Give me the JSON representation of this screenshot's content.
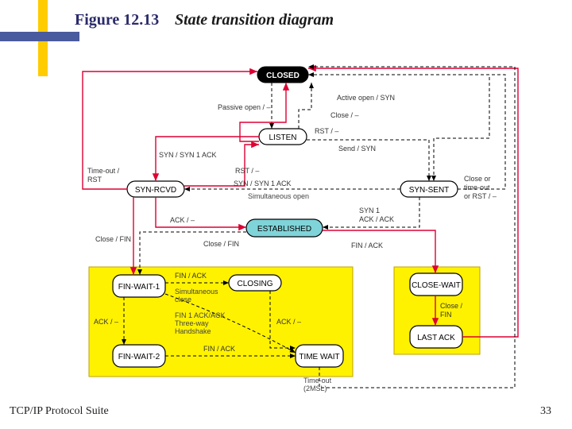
{
  "header": {
    "figure": "Figure 12.13",
    "title": "State transition diagram"
  },
  "footer": {
    "left": "TCP/IP Protocol Suite",
    "page": "33"
  },
  "states": {
    "closed": "CLOSED",
    "listen": "LISTEN",
    "syn_rcvd": "SYN-RCVD",
    "syn_sent": "SYN-SENT",
    "established": "ESTABLISHED",
    "fin_wait_1": "FIN-​WAIT-1",
    "closing": "CLOSING",
    "fin_wait_2": "FIN-​WAIT-2",
    "time_wait": "TIME​ WAIT",
    "close_wait": "CLOSE-​WAIT",
    "last_ack": "LAST​ ACK"
  },
  "edges": {
    "passive_open": "Passive open / –",
    "active_open": "Active open / SYN",
    "close": "Close / –",
    "rst": "RST / –",
    "syn_syn1ack": "SYN / SYN 1 ACK",
    "send_syn": "Send / SYN",
    "ack": "ACK / –",
    "syn1_ackack_l1": "SYN 1",
    "syn1_ackack_l2": "ACK / ACK",
    "sim_open": "Simultaneous open",
    "timeout_rst_l1": "Time-out /",
    "timeout_rst_l2": "RST",
    "close_fin": "Close / FIN",
    "fin_ack": "FIN / ACK",
    "sim_close_l1": "Simultaneous",
    "sim_close_l2": "close",
    "threeway_l1": "FIN 1 ACK/ACK",
    "threeway_l2": "Three-way",
    "threeway_l3": "Handshake",
    "close_fin2_l1": "Close /",
    "close_fin2_l2": "FIN",
    "close_or_timeout_l1": "Close or",
    "close_or_timeout_l2": "time-out",
    "close_or_timeout_l3": "or RST / –",
    "timeout_2msl_l1": "Time-out",
    "timeout_2msl_l2": "(2MSL)"
  }
}
